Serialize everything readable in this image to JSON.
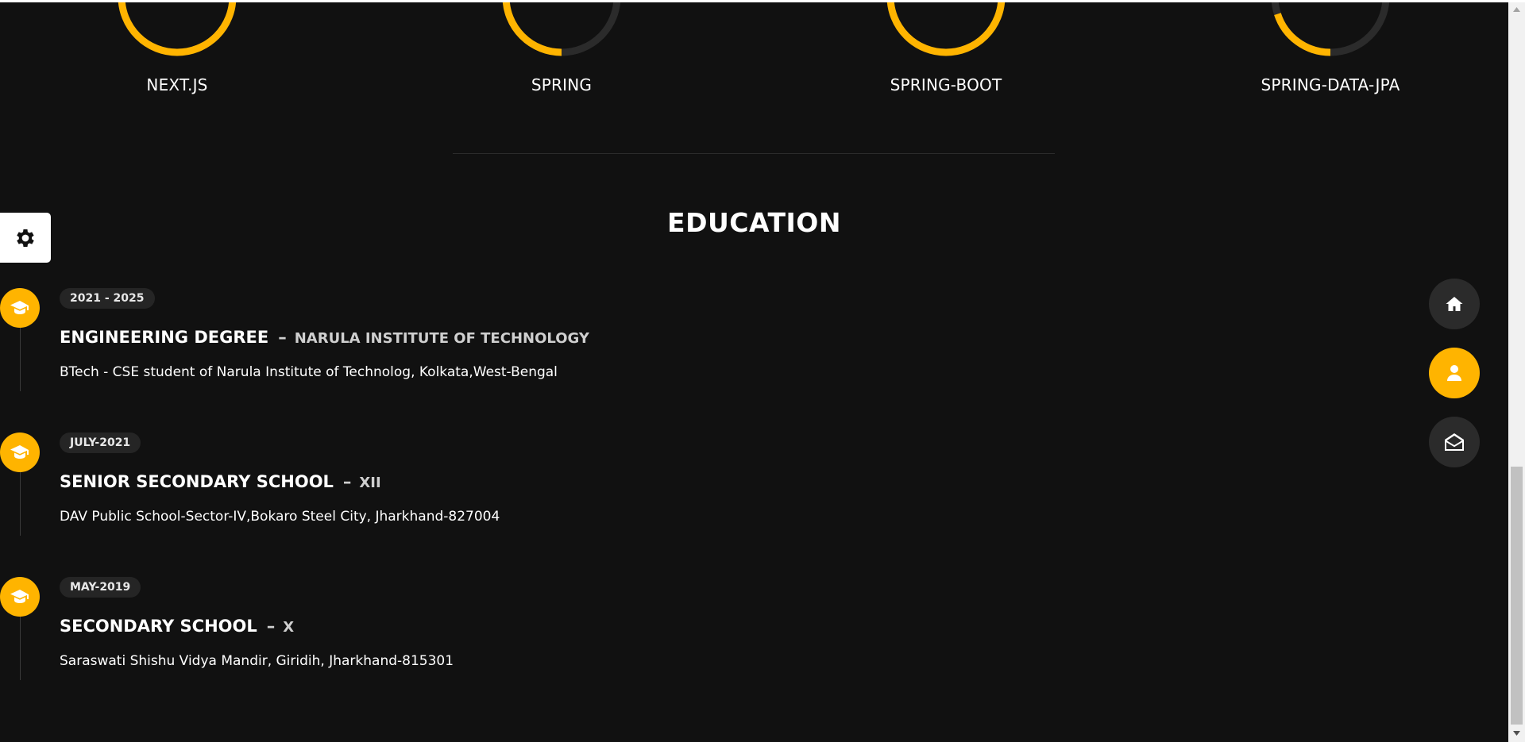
{
  "skills": [
    {
      "name": "NEXT.JS",
      "level": 0.5
    },
    {
      "name": "SPRING",
      "level": 0.25
    },
    {
      "name": "SPRING-BOOT",
      "level": 0.5
    },
    {
      "name": "SPRING-DATA-JPA",
      "level": 0.2
    }
  ],
  "education": {
    "title": "EDUCATION",
    "items": [
      {
        "date": "2021 - 2025",
        "title": "ENGINEERING DEGREE",
        "dash": "–",
        "place": "NARULA INSTITUTE OF TECHNOLOGY",
        "desc": "BTech - CSE student of Narula Institute of Technolog, Kolkata,West-Bengal",
        "icon": "graduation-cap-icon"
      },
      {
        "date": "JULY-2021",
        "title": "SENIOR SECONDARY SCHOOL",
        "dash": "–",
        "place": "XII",
        "desc": "DAV Public School-Sector-IV,Bokaro Steel City, Jharkhand-827004",
        "icon": "graduation-cap-icon"
      },
      {
        "date": "MAY-2019",
        "title": "SECONDARY SCHOOL",
        "dash": "–",
        "place": "X",
        "desc": "Saraswati Shishu Vidya Mandir, Giridih, Jharkhand-815301",
        "icon": "graduation-cap-icon"
      }
    ]
  },
  "nav": {
    "items": [
      {
        "icon": "home-icon",
        "active": false
      },
      {
        "icon": "user-icon",
        "active": true
      },
      {
        "icon": "envelope-open-icon",
        "active": false
      }
    ]
  },
  "settings": {
    "icon": "gear-icon"
  },
  "colors": {
    "accent": "#ffb400",
    "background": "#111111",
    "ring_track": "#2b2b2b"
  }
}
